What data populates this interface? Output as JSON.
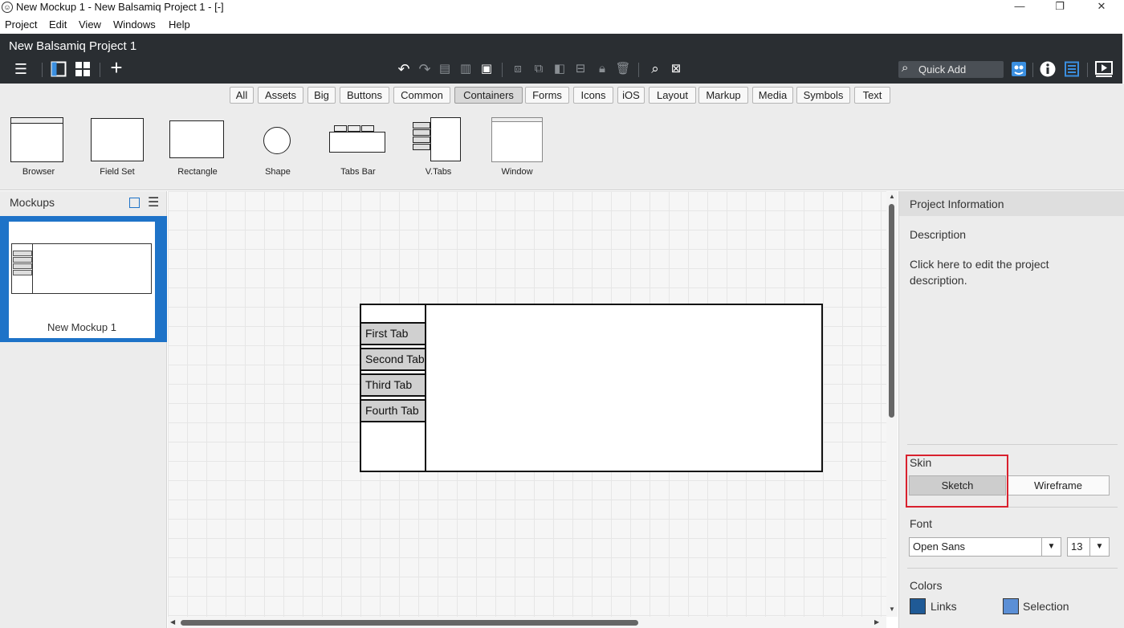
{
  "window": {
    "title": "New Mockup 1 - New Balsamiq Project 1 - [-]",
    "minimize": "—",
    "restore": "❐",
    "close": "✕"
  },
  "menu": [
    "Project",
    "Edit",
    "View",
    "Windows",
    "Help"
  ],
  "toolbar": {
    "project_name": "New Balsamiq Project 1",
    "quick_add_placeholder": "Quick Add"
  },
  "filters": [
    "All",
    "Assets",
    "Big",
    "Buttons",
    "Common",
    "Containers",
    "Forms",
    "Icons",
    "iOS",
    "Layout",
    "Markup",
    "Media",
    "Symbols",
    "Text"
  ],
  "active_filter": "Containers",
  "library": [
    "Browser",
    "Field Set",
    "Rectangle",
    "Shape",
    "Tabs Bar",
    "V.Tabs",
    "Window"
  ],
  "mockups_panel": {
    "title": "Mockups",
    "items": [
      {
        "label": "New Mockup 1"
      }
    ]
  },
  "canvas": {
    "vtabs": [
      "First Tab",
      "Second Tab",
      "Third Tab",
      "Fourth Tab"
    ]
  },
  "project_info": {
    "title": "Project Information",
    "description_label": "Description",
    "description_text": "Click here to edit the project description.",
    "skin_label": "Skin",
    "skin_options": [
      "Sketch",
      "Wireframe"
    ],
    "skin_selected": "Sketch",
    "font_label": "Font",
    "font_value": "Open Sans",
    "font_size": "13",
    "colors_label": "Colors",
    "links_label": "Links",
    "selection_label": "Selection",
    "links_color": "#1f5a96",
    "selection_color": "#5b8fd6"
  },
  "colors": {
    "toolbar_bg": "#2a2e32",
    "selection_blue": "#1e73c8",
    "highlight_red": "#d9212e"
  }
}
